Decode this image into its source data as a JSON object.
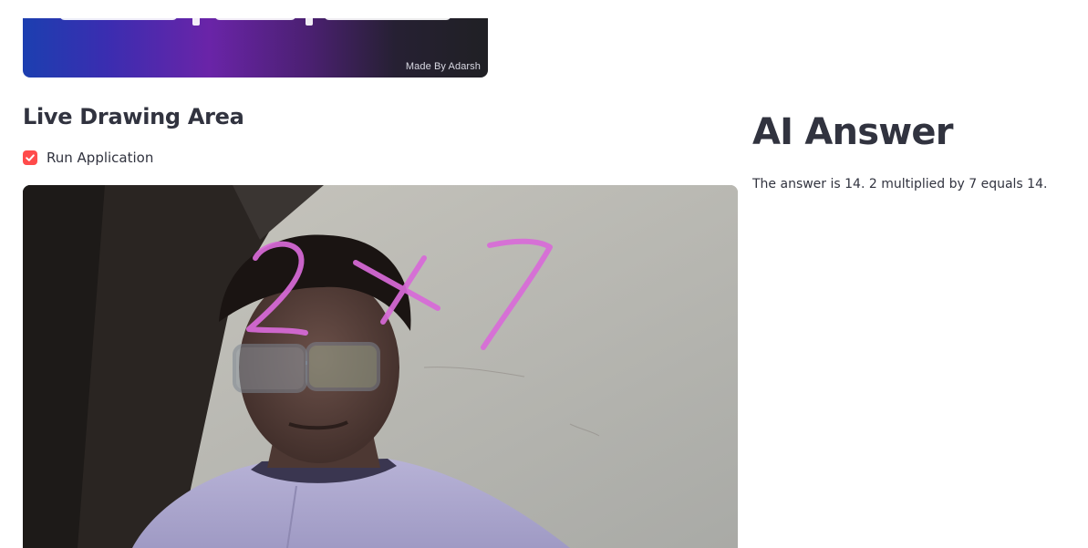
{
  "banner": {
    "credit": "Made By Adarsh"
  },
  "left": {
    "section_title": "Live Drawing Area",
    "checkbox": {
      "label": "Run Application",
      "checked": true,
      "color": "#ff4b4b"
    },
    "video": {
      "drawn_text": "2×7",
      "stroke_color": "#d86ad8"
    }
  },
  "right": {
    "title": "AI Answer",
    "answer": "The answer is 14. 2 multiplied by 7 equals 14."
  },
  "icons": {
    "checkbox": "check-icon"
  }
}
